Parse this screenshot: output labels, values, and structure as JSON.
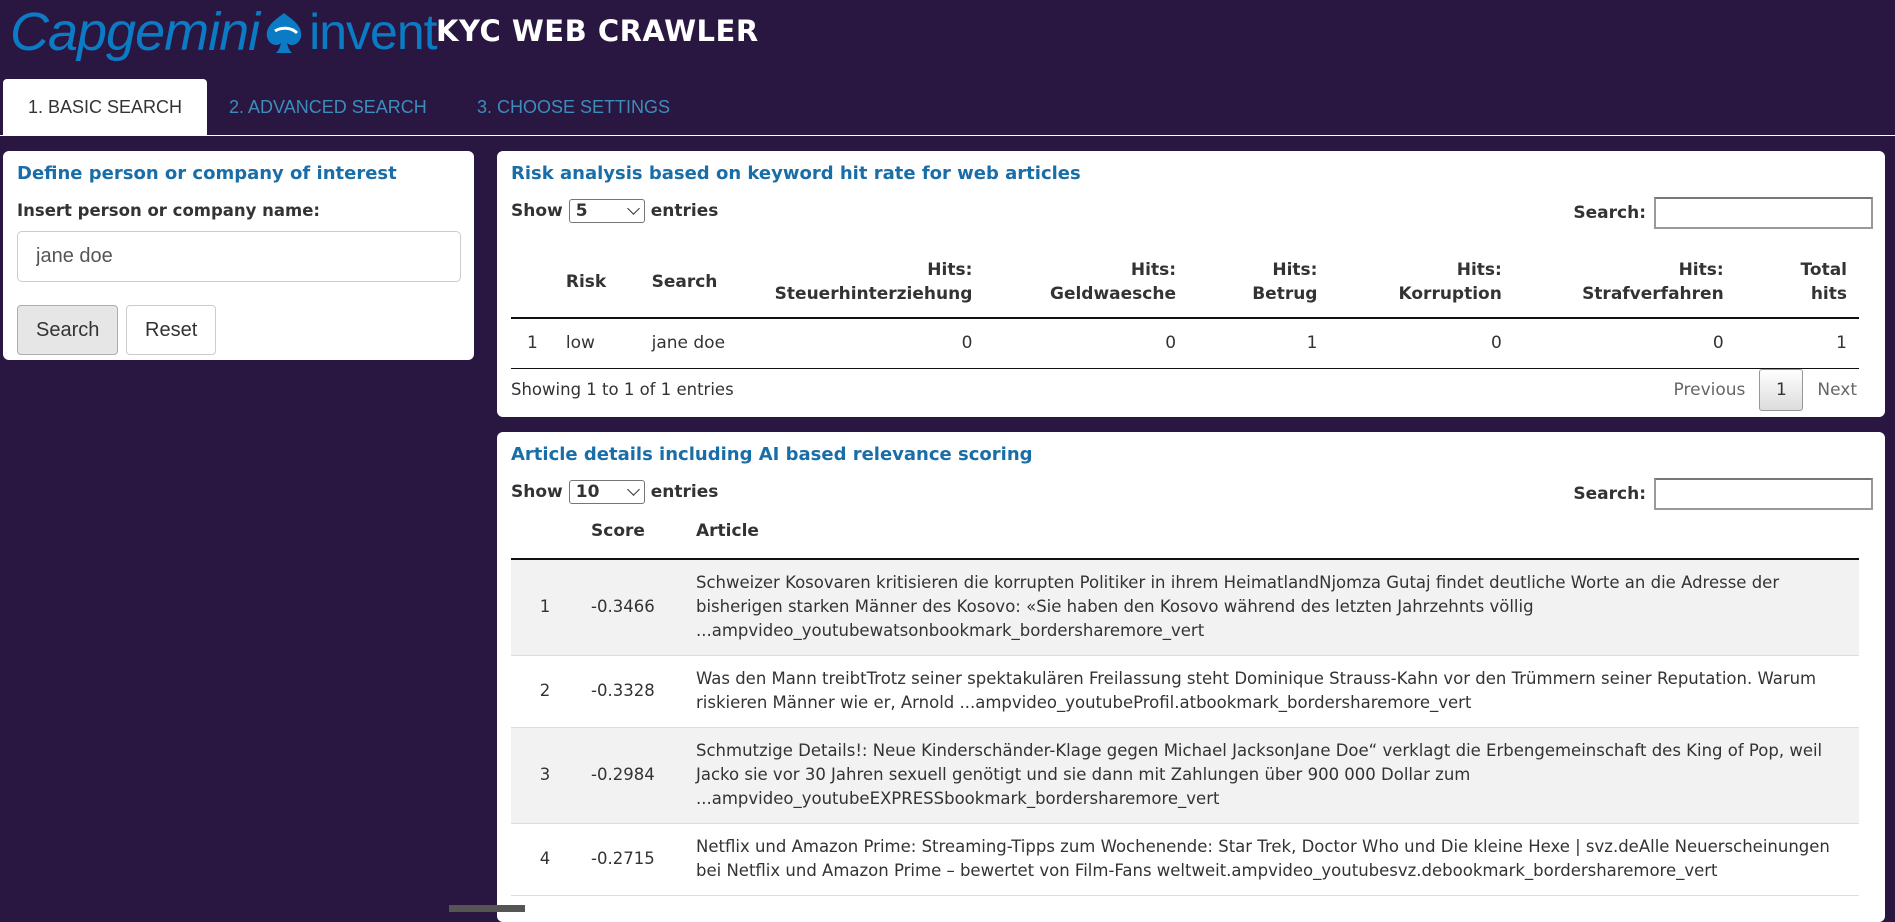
{
  "header": {
    "logo_left": "Capgemini",
    "logo_right": "invent",
    "title": "KYC WEB CRAWLER"
  },
  "tabs": [
    {
      "label": "1. BASIC SEARCH",
      "active": true
    },
    {
      "label": "2. ADVANCED SEARCH",
      "active": false
    },
    {
      "label": "3. CHOOSE SETTINGS",
      "active": false
    }
  ],
  "search_panel": {
    "title": "Define person or company of interest",
    "input_label": "Insert person or company name:",
    "input_value": "jane doe",
    "search_button": "Search",
    "reset_button": "Reset"
  },
  "risk_table": {
    "title": "Risk analysis based on keyword hit rate for web articles",
    "show_label": "Show",
    "entries_value": "5",
    "entries_label": "entries",
    "search_label": "Search:",
    "columns": [
      "",
      "Risk",
      "Search",
      "Hits: Steuerhinterziehung",
      "Hits: Geldwaesche",
      "Hits: Betrug",
      "Hits: Korruption",
      "Hits: Strafverfahren",
      "Total hits"
    ],
    "header_top": [
      "Hits:",
      "Hits:",
      "Hits:",
      "Hits:",
      "Hits:",
      "Total"
    ],
    "header_bottom": [
      "Steuerhinterziehung",
      "Geldwaesche",
      "Betrug",
      "Korruption",
      "Strafverfahren",
      "hits"
    ],
    "rows": [
      {
        "idx": "1",
        "risk": "low",
        "search": "jane doe",
        "steuer": "0",
        "geld": "0",
        "betrug": "1",
        "korruption": "0",
        "straf": "0",
        "total": "1"
      }
    ],
    "info": "Showing 1 to 1 of 1 entries",
    "prev": "Previous",
    "page": "1",
    "next": "Next"
  },
  "article_table": {
    "title": "Article details including AI based relevance scoring",
    "show_label": "Show",
    "entries_value": "10",
    "entries_label": "entries",
    "search_label": "Search:",
    "col_score": "Score",
    "col_article": "Article",
    "rows": [
      {
        "idx": "1",
        "score": "-0.3466",
        "article": "Schweizer Kosovaren kritisieren die korrupten Politiker in ihrem HeimatlandNjomza Gutaj findet deutliche Worte an die Adresse der bisherigen starken Männer des Kosovo: «Sie haben den Kosovo während des letzten Jahrzehnts völlig ...ampvideo_youtubewatsonbookmark_bordersharemore_vert"
      },
      {
        "idx": "2",
        "score": "-0.3328",
        "article": "Was den Mann treibtTrotz seiner spektakulären Freilassung steht Dominique Strauss-Kahn vor den Trümmern seiner Reputation. Warum riskieren Männer wie er, Arnold ...ampvideo_youtubeProfil.atbookmark_bordersharemore_vert"
      },
      {
        "idx": "3",
        "score": "-0.2984",
        "article": "Schmutzige Details!: Neue Kinderschänder-Klage gegen Michael JacksonJane Doe“ verklagt die Erbengemeinschaft des King of Pop, weil Jacko sie vor 30 Jahren sexuell genötigt und sie dann mit Zahlungen über 900 000 Dollar zum ...ampvideo_youtubeEXPRESSbookmark_bordersharemore_vert"
      },
      {
        "idx": "4",
        "score": "-0.2715",
        "article": "Netflix und Amazon Prime: Streaming-Tipps zum Wochenende: Star Trek, Doctor Who und Die kleine Hexe | svz.deAlle Neuerscheinungen bei Netflix und Amazon Prime – bewertet von Film-Fans weltweit.ampvideo_youtubesvz.debookmark_bordersharemore_vert"
      }
    ]
  },
  "colors": {
    "background": "#2a1741",
    "accent": "#1a6ea8",
    "tab_link": "#3c8dbc"
  }
}
